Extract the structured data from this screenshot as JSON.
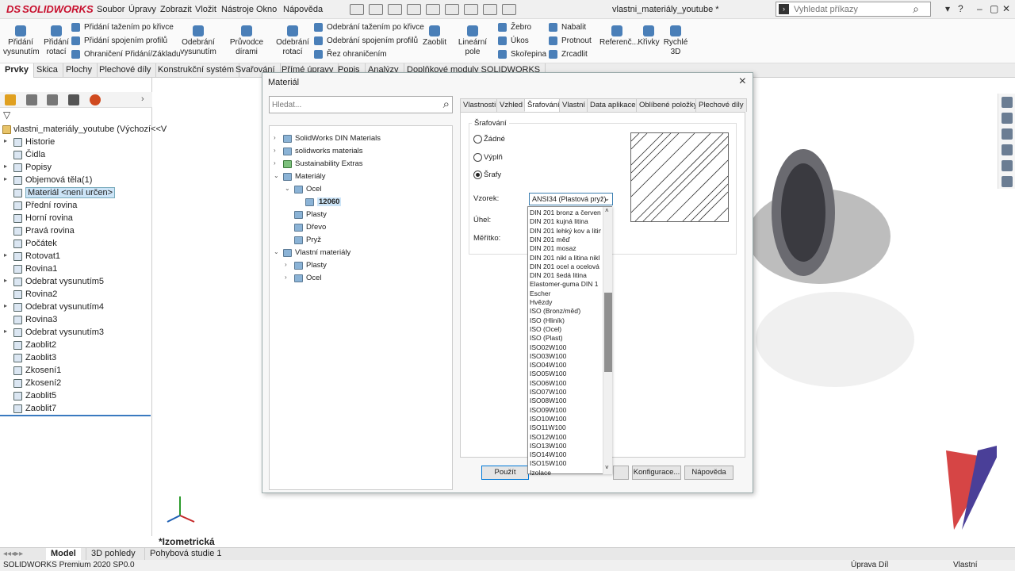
{
  "app": {
    "logo": "SOLIDWORKS",
    "logo_mark": "DS",
    "document_title": "vlastni_materiály_youtube *"
  },
  "menu": [
    "Soubor",
    "Úpravy",
    "Zobrazit",
    "Vložit",
    "Nástroje",
    "Okno",
    "Nápověda"
  ],
  "search": {
    "placeholder": "Vyhledat příkazy"
  },
  "ribbon": {
    "pridani_vysunutim": "Přidání vysunutím",
    "pridani_rotaci": "Přidání rotací",
    "pridani_tazenim": "Přidání tažením po křivce",
    "pridani_spojenim": "Přidání spojením profilů",
    "ohraniceni": "Ohraničení Přidání/Základu",
    "odebrani_vysunutim": "Odebrání vysunutím",
    "pruvodce_dirami": "Průvodce dírami",
    "odebrani_rotaci": "Odebrání rotací",
    "odebrani_tazenim": "Odebrání tažením po křivce",
    "odebrani_spojenim": "Odebrání spojením profilů",
    "rez_ohranicenim": "Řez ohraničením",
    "zaoblit": "Zaoblit",
    "linearni_pole": "Lineární pole",
    "zebro": "Žebro",
    "ukos": "Úkos",
    "skorepina": "Skořepina",
    "nabalit": "Nabalit",
    "protnout": "Protnout",
    "zrcadlit": "Zrcadlit",
    "referencni": "Referenč...",
    "krivky": "Křivky",
    "rychle_3d": "Rychlé 3D"
  },
  "tabs": [
    "Prvky",
    "Skica",
    "Plochy",
    "Plechové díly",
    "Konstrukční systém",
    "Svařování",
    "Přímé úpravy",
    "Popis",
    "Analýzy",
    "Doplňkové moduly SOLIDWORKS"
  ],
  "tree": {
    "root": "vlastni_materiály_youtube  (Výchozí<<V",
    "items": [
      {
        "label": "Historie",
        "exp": "▸"
      },
      {
        "label": "Čidla",
        "exp": ""
      },
      {
        "label": "Popisy",
        "exp": "▸"
      },
      {
        "label": "Objemová těla(1)",
        "exp": "▸"
      },
      {
        "label": "Materiál <není určen>",
        "exp": "",
        "selected": true
      },
      {
        "label": "Přední rovina",
        "exp": ""
      },
      {
        "label": "Horní rovina",
        "exp": ""
      },
      {
        "label": "Pravá rovina",
        "exp": ""
      },
      {
        "label": "Počátek",
        "exp": ""
      },
      {
        "label": "Rotovat1",
        "exp": "▸"
      },
      {
        "label": "Rovina1",
        "exp": ""
      },
      {
        "label": "Odebrat vysunutím5",
        "exp": "▸"
      },
      {
        "label": "Rovina2",
        "exp": ""
      },
      {
        "label": "Odebrat vysunutím4",
        "exp": "▸"
      },
      {
        "label": "Rovina3",
        "exp": ""
      },
      {
        "label": "Odebrat vysunutím3",
        "exp": "▸"
      },
      {
        "label": "Zaoblit2",
        "exp": ""
      },
      {
        "label": "Zaoblit3",
        "exp": ""
      },
      {
        "label": "Zkosení1",
        "exp": ""
      },
      {
        "label": "Zkosení2",
        "exp": ""
      },
      {
        "label": "Zaoblit5",
        "exp": ""
      },
      {
        "label": "Zaoblit7",
        "exp": ""
      }
    ]
  },
  "viewport": {
    "view_name": "*Izometrická"
  },
  "bottom_tabs": [
    "Model",
    "3D pohledy",
    "Pohybová studie 1"
  ],
  "status": {
    "left": "SOLIDWORKS Premium 2020 SP0.0",
    "mid": "Úprava Díl",
    "right": "Vlastní"
  },
  "dialog": {
    "title": "Materiál",
    "search_placeholder": "Hledat...",
    "library": [
      {
        "label": "SolidWorks DIN Materials",
        "exp": "›",
        "level": 0,
        "green": false
      },
      {
        "label": "solidworks materials",
        "exp": "›",
        "level": 0,
        "green": false
      },
      {
        "label": "Sustainability Extras",
        "exp": "›",
        "level": 0,
        "green": true
      },
      {
        "label": "Materiály",
        "exp": "⌄",
        "level": 0,
        "green": false
      },
      {
        "label": "Ocel",
        "exp": "⌄",
        "level": 1,
        "green": false
      },
      {
        "label": "12060",
        "exp": "",
        "level": 2,
        "green": false,
        "selected": true
      },
      {
        "label": "Plasty",
        "exp": "",
        "level": 1,
        "green": false
      },
      {
        "label": "Dřevo",
        "exp": "",
        "level": 1,
        "green": false
      },
      {
        "label": "Pryž",
        "exp": "",
        "level": 1,
        "green": false
      },
      {
        "label": "Vlastní materiály",
        "exp": "⌄",
        "level": 0,
        "green": false
      },
      {
        "label": "Plasty",
        "exp": "›",
        "level": 1,
        "green": false
      },
      {
        "label": "Ocel",
        "exp": "›",
        "level": 1,
        "green": false
      }
    ],
    "prop_tabs": [
      "Vlastnosti",
      "Vzhled",
      "Šrafování",
      "Vlastní",
      "Data aplikace",
      "Oblíbené položky",
      "Plechové díly"
    ],
    "group_title": "Šrafování",
    "radios": [
      "Žádné",
      "Výplň",
      "Šrafy"
    ],
    "pattern_label": "Vzorek:",
    "pattern_value": "ANSI34 (Plastová pryž)",
    "angle_label": "Úhel:",
    "scale_label": "Měřítko:",
    "dropdown_options": [
      "DIN 201 bronz a červen",
      "DIN 201 kujná litina",
      "DIN 201 lehký kov a litin",
      "DIN 201 měď",
      "DIN 201 mosaz",
      "DIN 201 nikl a litina nikl",
      "DIN 201 ocel a ocelová",
      "DIN 201 šedá litina",
      "Elastomer-guma DIN 1",
      "Escher",
      "Hvězdy",
      "ISO (Bronz/měď)",
      "ISO (Hliník)",
      "ISO (Ocel)",
      "ISO (Plast)",
      "ISO02W100",
      "ISO03W100",
      "ISO04W100",
      "ISO05W100",
      "ISO06W100",
      "ISO07W100",
      "ISO08W100",
      "ISO09W100",
      "ISO10W100",
      "ISO11W100",
      "ISO12W100",
      "ISO13W100",
      "ISO14W100",
      "ISO15W100",
      "Izolace"
    ],
    "buttons": {
      "apply": "Použít",
      "config": "Konfigurace...",
      "help": "Nápověda"
    }
  }
}
